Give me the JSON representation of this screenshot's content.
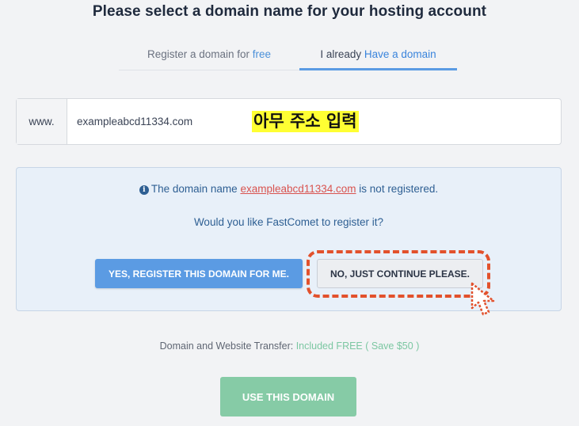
{
  "page": {
    "title": "Please select a domain name for your hosting account"
  },
  "tabs": {
    "register": {
      "prefix": "Register a domain for ",
      "highlight": "free"
    },
    "have": {
      "prefix": "I already ",
      "highlight": "Have a domain"
    }
  },
  "domain": {
    "prefix": "www.",
    "value": "exampleabcd11334.com"
  },
  "annotation": {
    "label": "아무 주소 입력"
  },
  "info": {
    "icon": "info-circle-icon",
    "line_prefix": "The domain name ",
    "domain_link": "exampleabcd11334.com",
    "line_suffix": " is not registered.",
    "question": "Would you like FastComet to register it?",
    "yes_button": "YES, REGISTER THIS DOMAIN FOR ME.",
    "no_button": "NO, JUST CONTINUE PLEASE."
  },
  "transfer": {
    "label": "Domain and Website Transfer: ",
    "included": "Included FREE",
    "paren_open": " ( ",
    "save": "Save $50",
    "paren_close": " )"
  },
  "actions": {
    "use_button": "USE THIS DOMAIN"
  },
  "colors": {
    "accent_blue": "#5b9be3",
    "green": "#86cba6",
    "link_red": "#d9534f",
    "highlight_dash": "#e2512c",
    "annotation_yellow": "#ffff33"
  }
}
